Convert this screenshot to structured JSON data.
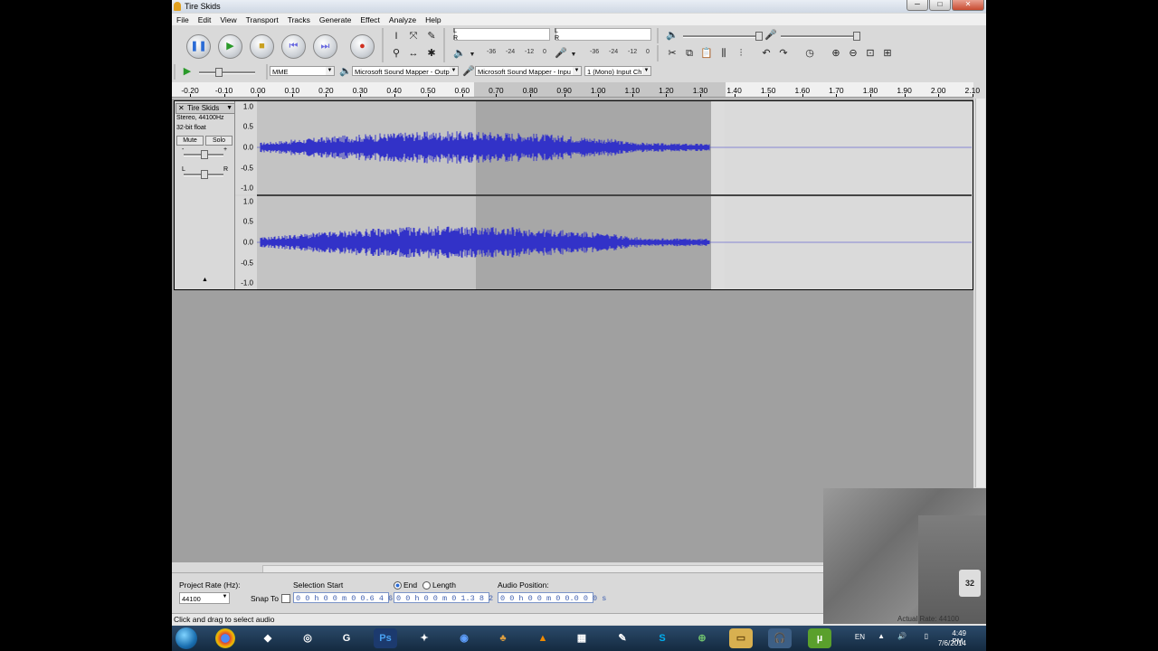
{
  "window": {
    "title": "Tire Skids",
    "minimize": "─",
    "maximize": "□",
    "close": "✕"
  },
  "menu": [
    "File",
    "Edit",
    "View",
    "Transport",
    "Tracks",
    "Generate",
    "Effect",
    "Analyze",
    "Help"
  ],
  "transport": {
    "pause_icon": "pause-icon",
    "play_icon": "play-icon",
    "stop_icon": "stop-icon",
    "skip_start_icon": "skip-start-icon",
    "skip_end_icon": "skip-end-icon",
    "record_icon": "record-icon"
  },
  "meters": {
    "play_L": "L",
    "play_R": "R",
    "rec_L": "L",
    "rec_R": "R",
    "scale_play": [
      "-36",
      "-24",
      "-12",
      "0"
    ],
    "scale_rec": [
      "-36",
      "-24",
      "-12",
      "0"
    ]
  },
  "device": {
    "host": "MME",
    "output": "Microsoft Sound Mapper - Outp",
    "input": "Microsoft Sound Mapper - Inpu",
    "channels": "1 (Mono) Input Ch"
  },
  "ruler": {
    "ticks": [
      "-0.20",
      "-0.10",
      "0.00",
      "0.10",
      "0.20",
      "0.30",
      "0.40",
      "0.50",
      "0.60",
      "0.70",
      "0.80",
      "0.90",
      "1.00",
      "1.10",
      "1.20",
      "1.30",
      "1.40",
      "1.50",
      "1.60",
      "1.70",
      "1.80",
      "1.90",
      "2.00",
      "2.10"
    ]
  },
  "track": {
    "name": "Tire Skids",
    "format": "Stereo, 44100Hz",
    "bits": "32-bit float",
    "mute": "Mute",
    "solo": "Solo",
    "gain_minus": "-",
    "gain_plus": "+",
    "pan_left": "L",
    "pan_right": "R",
    "collapse": "▲",
    "close": "✕",
    "menu_arrow": "▼",
    "axis": [
      "1.0",
      "0.5",
      "0.0",
      "-0.5",
      "-1.0"
    ],
    "waveform_color": "#3232c8"
  },
  "selection_bar": {
    "project_rate_label": "Project Rate (Hz):",
    "project_rate": "44100",
    "snap_to": "Snap To",
    "selection_start_label": "Selection Start",
    "end_label": "End",
    "length_label": "Length",
    "audio_position_label": "Audio Position:",
    "selection_start": "0 0 h 0 0 m 0 0.6 4 6 s",
    "selection_end": "0 0 h 0 0 m 0 1.3 8 2 s",
    "audio_position": "0 0 h 0 0 m 0 0.0 0 0 s"
  },
  "status": {
    "text": "Click and drag to select audio",
    "actual_rate": "Actual Rate: 44100"
  },
  "webcam": {
    "sign": "32"
  },
  "taskbar": {
    "apps": [
      "chrome",
      "unity",
      "steam",
      "gog",
      "photoshop",
      "blender",
      "browser",
      "game",
      "vlc",
      "video-editor",
      "app",
      "skype",
      "network",
      "explorer",
      "audacity",
      "utorrent"
    ],
    "lang": "EN",
    "time": "4:49 PM",
    "date": "7/6/2014"
  }
}
